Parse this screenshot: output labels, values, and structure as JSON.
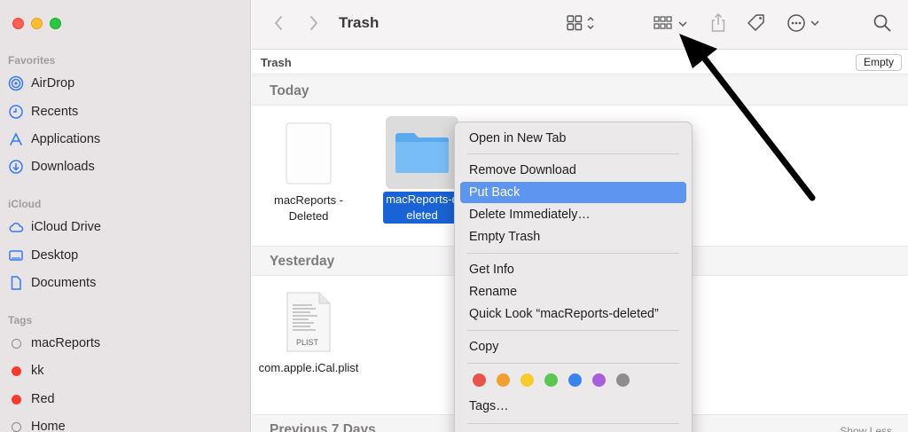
{
  "window": {
    "title": "Trash"
  },
  "sidebar": {
    "favorites_title": "Favorites",
    "favorites": [
      {
        "label": "AirDrop",
        "icon": "airdrop-icon"
      },
      {
        "label": "Recents",
        "icon": "clock-icon"
      },
      {
        "label": "Applications",
        "icon": "applications-icon"
      },
      {
        "label": "Downloads",
        "icon": "download-icon"
      }
    ],
    "icloud_title": "iCloud",
    "icloud": [
      {
        "label": "iCloud Drive",
        "icon": "cloud-icon"
      },
      {
        "label": "Desktop",
        "icon": "desktop-icon"
      },
      {
        "label": "Documents",
        "icon": "document-icon"
      }
    ],
    "tags_title": "Tags",
    "tags": [
      {
        "label": "macReports",
        "color": "none"
      },
      {
        "label": "kk",
        "color": "#f53b30"
      },
      {
        "label": "Red",
        "color": "#f53b30"
      },
      {
        "label": "Home",
        "color": "none"
      }
    ]
  },
  "pathbar": {
    "label": "Trash",
    "empty_button": "Empty"
  },
  "groups": [
    {
      "title": "Today"
    },
    {
      "title": "Yesterday"
    },
    {
      "title": "Previous 7 Days",
      "action": "Show Less"
    }
  ],
  "files": {
    "doc": "macReports - Deleted",
    "folder": "macReports-deleted",
    "plist": "com.apple.iCal.plist",
    "plist_badge": "PLIST"
  },
  "menu": {
    "items": [
      "Open in New Tab",
      "Remove Download",
      "Put Back",
      "Delete Immediately…",
      "Empty Trash",
      "Get Info",
      "Rename",
      "Quick Look “macReports-deleted”",
      "Copy",
      "Tags…"
    ],
    "tag_colors": [
      "#e8534a",
      "#f0a030",
      "#f5cb2e",
      "#5cc651",
      "#3b82f0",
      "#a75fdb",
      "#8e8e8e"
    ]
  }
}
